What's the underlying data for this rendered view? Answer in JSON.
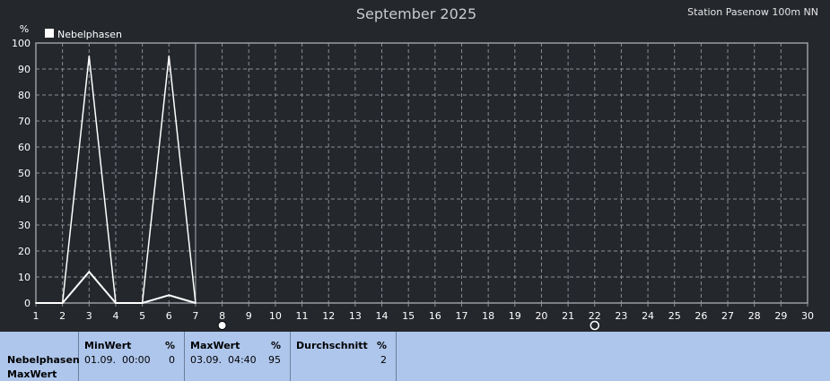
{
  "chart_data": {
    "type": "line",
    "title": "September 2025",
    "station": "Station Pasenow 100m NN",
    "yunit": "%",
    "ylim": [
      0,
      100
    ],
    "yticks": [
      0,
      10,
      20,
      30,
      40,
      50,
      60,
      70,
      80,
      90,
      100
    ],
    "xlim": [
      1,
      30
    ],
    "xticks": [
      1,
      2,
      3,
      4,
      5,
      6,
      7,
      8,
      9,
      10,
      11,
      12,
      13,
      14,
      15,
      16,
      17,
      18,
      19,
      20,
      21,
      22,
      23,
      24,
      25,
      26,
      27,
      28,
      29,
      30
    ],
    "grid": true,
    "legend_position": "top-left",
    "current_day": 7,
    "series": [
      {
        "name": "Nebelphasen",
        "kind": "max",
        "color": "#ffffff",
        "points": [
          [
            1,
            0
          ],
          [
            2,
            0
          ],
          [
            3,
            95
          ],
          [
            4,
            0
          ],
          [
            5,
            0
          ],
          [
            6,
            95
          ],
          [
            7,
            0
          ]
        ]
      },
      {
        "kind": "average",
        "color": "#ffffff",
        "points": [
          [
            1,
            0
          ],
          [
            2,
            0
          ],
          [
            3,
            12
          ],
          [
            4,
            0
          ],
          [
            5,
            0
          ],
          [
            6,
            3
          ],
          [
            7,
            0
          ]
        ]
      }
    ],
    "moon_phases": [
      {
        "day": 8,
        "phase": "full-moon"
      },
      {
        "day": 22,
        "phase": "new-moon"
      }
    ]
  },
  "stats": {
    "row_label_1": "Nebelphasen",
    "row_label_2": "MaxWert",
    "columns": [
      {
        "header": "MinWert",
        "unit": "%",
        "time": "01.09.  00:00",
        "value": "0"
      },
      {
        "header": "MaxWert",
        "unit": "%",
        "time": "03.09.  04:40",
        "value": "95"
      },
      {
        "header": "Durchschnitt",
        "unit": "%",
        "time": "",
        "value": "2"
      }
    ]
  },
  "colors": {
    "background": "#24272c",
    "grid": "#8a8d92",
    "axis_text": "#ffffff",
    "title": "#c8cacd",
    "table_bg": "#aec6ec"
  }
}
